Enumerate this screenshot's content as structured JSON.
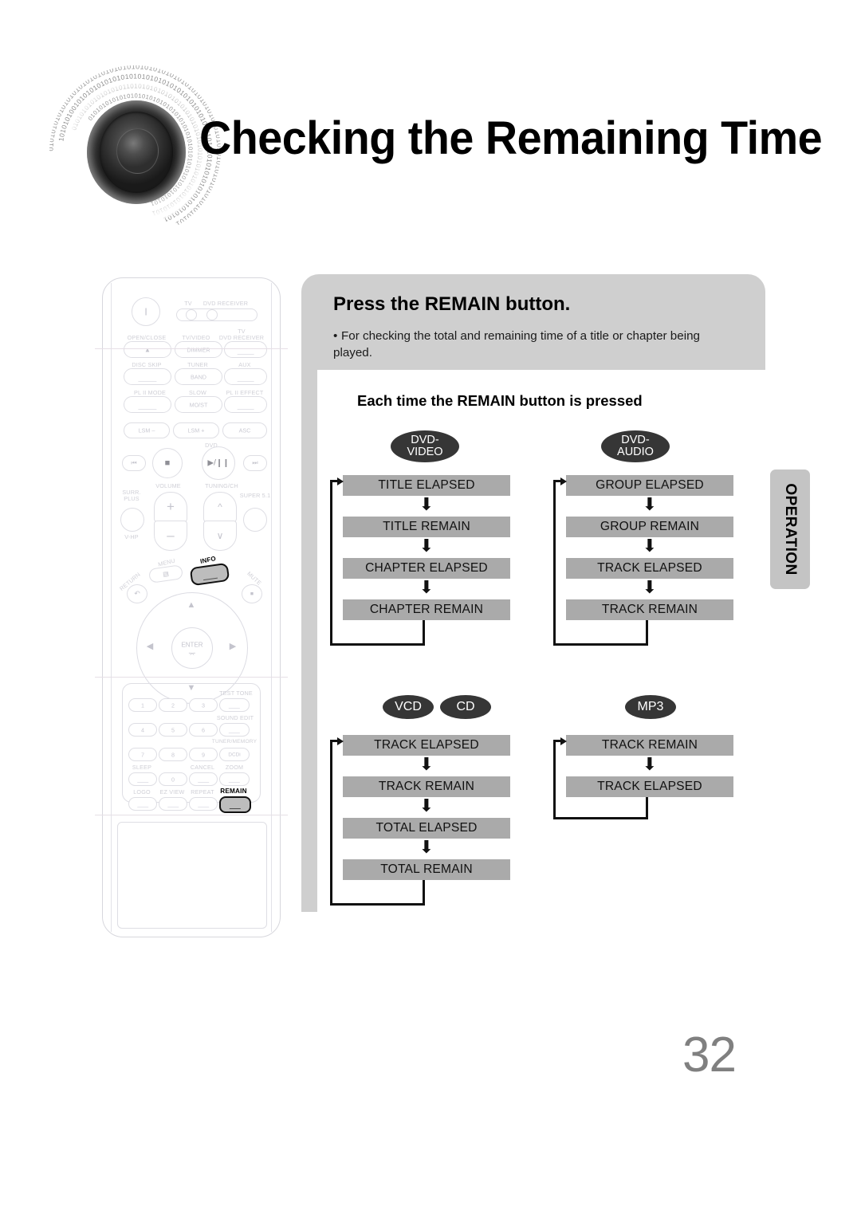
{
  "header": {
    "title": "Checking the Remaining Time",
    "speaker_icon": "speaker-binary-ring-icon"
  },
  "instruction": {
    "title": "Press the REMAIN button.",
    "bullet": "For checking the total and remaining time of a title or chapter being played.",
    "flow_heading": "Each time the REMAIN button is pressed"
  },
  "side_tab": {
    "label": "OPERATION"
  },
  "flows": [
    {
      "id": "dvd-video",
      "badges": [
        "DVD-\nVIDEO"
      ],
      "steps": [
        "TITLE ELAPSED",
        "TITLE REMAIN",
        "CHAPTER ELAPSED",
        "CHAPTER REMAIN"
      ],
      "arrow": "⬇",
      "loops_back": true
    },
    {
      "id": "dvd-audio",
      "badges": [
        "DVD-\nAUDIO"
      ],
      "steps": [
        "GROUP ELAPSED",
        "GROUP REMAIN",
        "TRACK ELAPSED",
        "TRACK REMAIN"
      ],
      "arrow": "⬇",
      "loops_back": true
    },
    {
      "id": "vcd-cd",
      "badges": [
        "VCD",
        "CD"
      ],
      "steps": [
        "TRACK ELAPSED",
        "TRACK REMAIN",
        "TOTAL ELAPSED",
        "TOTAL REMAIN"
      ],
      "arrow": "⬇",
      "loops_back": true
    },
    {
      "id": "mp3",
      "badges": [
        "MP3"
      ],
      "steps": [
        "TRACK REMAIN",
        "TRACK ELAPSED"
      ],
      "arrow": "⬇",
      "loops_back": true
    }
  ],
  "remote": {
    "power_icon": "power-icon",
    "indicators": {
      "tv": "TV",
      "dvd_receiver": "DVD RECEIVER"
    },
    "labels": {
      "open_close": "OPEN/CLOSE",
      "tv_video": "TV/VIDEO",
      "tv2": "TV",
      "dvd_receiver2": "DVD RECEIVER",
      "disc_skip": "DISC SKIP",
      "tuner": "TUNER",
      "aux": "AUX",
      "pl2_mode": "PL II MODE",
      "slow": "SLOW",
      "pl2_effect": "PL II EFFECT",
      "dvd": "DVD",
      "volume": "VOLUME",
      "tuning_ch": "TUNING/CH",
      "surr_plus": "SURR.\nPLUS",
      "v_hp": "V-HP",
      "super51": "SUPER 5.1",
      "menu": "MENU",
      "info": "INFO",
      "return": "RETURN",
      "mute": "MUTE",
      "test_tone": "TEST TONE",
      "sound_edit": "SOUND EDIT",
      "tuner_memory": "TUNER/MEMORY",
      "sleep": "SLEEP",
      "cancel": "CANCEL",
      "zoom": "ZOOM",
      "logo": "LOGO",
      "ez_view": "EZ VIEW",
      "repeat": "REPEAT",
      "remain": "REMAIN"
    },
    "buttons": {
      "dimmer": "DIMMER",
      "band": "BAND",
      "mo_st": "MO/ST",
      "lsm_minus": "LSM –",
      "lsm_plus": "LSM +",
      "asc": "ASC",
      "enter": "ENTER",
      "dcdi": "DCDi",
      "zero": "0"
    },
    "numbers": [
      "1",
      "2",
      "3",
      "4",
      "5",
      "6",
      "7",
      "8",
      "9"
    ],
    "transport": {
      "prev": "⏮",
      "stop": "■",
      "play_pause": "▶/❙❙",
      "next": "⏭"
    },
    "highlighted": [
      "INFO",
      "REMAIN"
    ]
  },
  "page_number": "32",
  "colors": {
    "panel_gray": "#cfcfcf",
    "flow_box_gray": "#aaaaaa",
    "badge_dark": "#363636",
    "tab_gray": "#c4c4c4",
    "page_number_gray": "#808080"
  }
}
